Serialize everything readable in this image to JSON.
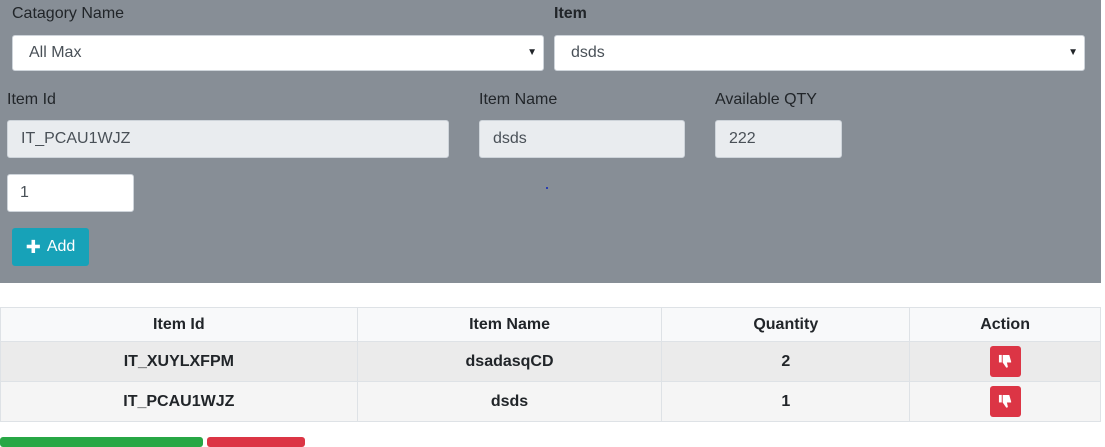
{
  "form": {
    "category_label": "Catagory Name",
    "category_value": "All Max",
    "item_label": "Item",
    "item_value": "dsds",
    "item_id_label": "Item Id",
    "item_id_value": "IT_PCAU1WJZ",
    "item_name_label": "Item Name",
    "item_name_value": "dsds",
    "available_qty_label": "Available QTY",
    "available_qty_value": "222",
    "quantity_value": "1",
    "add_label": "Add"
  },
  "table": {
    "headers": [
      "Item Id",
      "Item Name",
      "Quantity",
      "Action"
    ],
    "rows": [
      {
        "item_id": "IT_XUYLXFPM",
        "item_name": "dsadasqCD",
        "quantity": "2"
      },
      {
        "item_id": "IT_PCAU1WJZ",
        "item_name": "dsds",
        "quantity": "1"
      }
    ]
  },
  "icons": {
    "dropdown": "caret-down-icon",
    "add": "plus-icon",
    "delete": "thumbs-down-icon"
  },
  "colors": {
    "panel_bg": "#878e96",
    "add_button": "#17a2b8",
    "delete_button": "#dc3545",
    "bottom_primary": "#28a745",
    "bottom_secondary": "#dc3545"
  }
}
